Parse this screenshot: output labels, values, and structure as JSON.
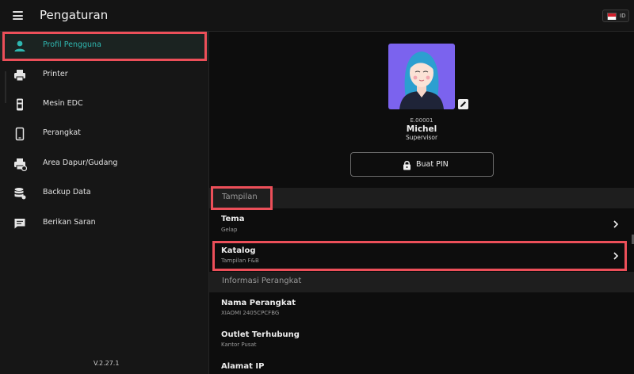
{
  "header": {
    "title": "Pengaturan",
    "language_code": "ID"
  },
  "sidebar": {
    "items": [
      {
        "label": "Profil Pengguna",
        "icon": "user-icon"
      },
      {
        "label": "Printer",
        "icon": "printer-icon"
      },
      {
        "label": "Mesin EDC",
        "icon": "edc-machine-icon"
      },
      {
        "label": "Perangkat",
        "icon": "smartphone-icon"
      },
      {
        "label": "Area Dapur/Gudang",
        "icon": "kitchen-printer-icon"
      },
      {
        "label": "Backup Data",
        "icon": "database-icon"
      },
      {
        "label": "Berikan Saran",
        "icon": "feedback-icon"
      }
    ],
    "version": "V.2.27.1"
  },
  "profile": {
    "employee_id": "E.00001",
    "name": "Michel",
    "role": "Supervisor",
    "pin_button": "Buat PIN"
  },
  "sections": {
    "tampilan": {
      "title": "Tampilan",
      "rows": [
        {
          "title": "Tema",
          "subtitle": "Gelap"
        },
        {
          "title": "Katalog",
          "subtitle": "Tampilan F&B"
        }
      ]
    },
    "info": {
      "title": "Informasi Perangkat",
      "rows": [
        {
          "title": "Nama Perangkat",
          "subtitle": "XIAOMI 2405CPCFBG"
        },
        {
          "title": "Outlet Terhubung",
          "subtitle": "Kantor Pusat"
        },
        {
          "title": "Alamat IP",
          "subtitle": ""
        }
      ]
    }
  },
  "colors": {
    "accent": "#2fb7b0",
    "highlight": "#ec4f59",
    "background": "#0d0d0d",
    "sidebar_bg": "#161616",
    "section_bg": "#1e1e1e",
    "avatar_bg": "#7b63ee"
  }
}
